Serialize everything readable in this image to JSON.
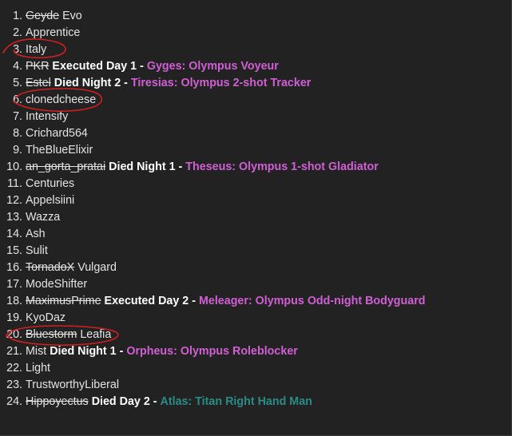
{
  "colors": {
    "background": "#222222",
    "text": "#e4e4e4",
    "status_text": "#ffffff",
    "role_olympus": "#d15fd4",
    "role_titan": "#2a8c86",
    "annotation": "#d31f1f"
  },
  "players": [
    {
      "num": "1.",
      "struck": "Geyde",
      "name": "Evo",
      "status": "",
      "role": "",
      "role_color": ""
    },
    {
      "num": "2.",
      "struck": "",
      "name": "Apprentice",
      "status": "",
      "role": "",
      "role_color": ""
    },
    {
      "num": "3.",
      "struck": "",
      "name": "Italy",
      "status": "",
      "role": "",
      "role_color": "",
      "circled": true
    },
    {
      "num": "4.",
      "struck": "PKR",
      "name": "",
      "status": "Executed Day 1 -",
      "role": "Gyges: Olympus Voyeur",
      "role_color": "pink"
    },
    {
      "num": "5.",
      "struck": "Estel",
      "name": "",
      "status": "Died Night 2 -",
      "role": "Tiresias: Olympus 2-shot Tracker",
      "role_color": "pink"
    },
    {
      "num": "6.",
      "struck": "",
      "name": "clonedcheese",
      "status": "",
      "role": "",
      "role_color": "",
      "circled": true
    },
    {
      "num": "7.",
      "struck": "",
      "name": "Intensify",
      "status": "",
      "role": "",
      "role_color": ""
    },
    {
      "num": "8.",
      "struck": "",
      "name": "Crichard564",
      "status": "",
      "role": "",
      "role_color": ""
    },
    {
      "num": "9.",
      "struck": "",
      "name": "TheBlueElixir",
      "status": "",
      "role": "",
      "role_color": ""
    },
    {
      "num": "10.",
      "struck": "an_gorta_pratai",
      "name": "",
      "status": "Died Night 1 -",
      "role": "Theseus: Olympus 1-shot Gladiator",
      "role_color": "pink"
    },
    {
      "num": "11.",
      "struck": "",
      "name": "Centuries",
      "status": "",
      "role": "",
      "role_color": ""
    },
    {
      "num": "12.",
      "struck": "",
      "name": "Appelsiini",
      "status": "",
      "role": "",
      "role_color": ""
    },
    {
      "num": "13.",
      "struck": "",
      "name": "Wazza",
      "status": "",
      "role": "",
      "role_color": ""
    },
    {
      "num": "14.",
      "struck": "",
      "name": "Ash",
      "status": "",
      "role": "",
      "role_color": ""
    },
    {
      "num": "15.",
      "struck": "",
      "name": "Sulit",
      "status": "",
      "role": "",
      "role_color": ""
    },
    {
      "num": "16.",
      "struck": "TornadoX",
      "name": "Vulgard",
      "status": "",
      "role": "",
      "role_color": ""
    },
    {
      "num": "17.",
      "struck": "",
      "name": "ModeShifter",
      "status": "",
      "role": "",
      "role_color": ""
    },
    {
      "num": "18.",
      "struck": "MaximusPrime",
      "name": "",
      "status": "Executed Day 2 -",
      "role": "Meleager: Olympus Odd-night Bodyguard",
      "role_color": "pink"
    },
    {
      "num": "19.",
      "struck": "",
      "name": "KyoDaz",
      "status": "",
      "role": "",
      "role_color": ""
    },
    {
      "num": "20.",
      "struck": "Bluestorm",
      "name": "Leafia",
      "status": "",
      "role": "",
      "role_color": "",
      "circled": true
    },
    {
      "num": "21.",
      "struck": "",
      "name": "Mist",
      "status": "Died Night 1 -",
      "role": "Orpheus: Olympus Roleblocker",
      "role_color": "pink"
    },
    {
      "num": "22.",
      "struck": "",
      "name": "Light",
      "status": "",
      "role": "",
      "role_color": ""
    },
    {
      "num": "23.",
      "struck": "",
      "name": "TrustworthyLiberal",
      "status": "",
      "role": "",
      "role_color": ""
    },
    {
      "num": "24.",
      "struck": "Hippoyectus",
      "name": "",
      "status": "Died Day 2 -",
      "role": "Atlas: Titan Right Hand Man",
      "role_color": "teal"
    }
  ]
}
